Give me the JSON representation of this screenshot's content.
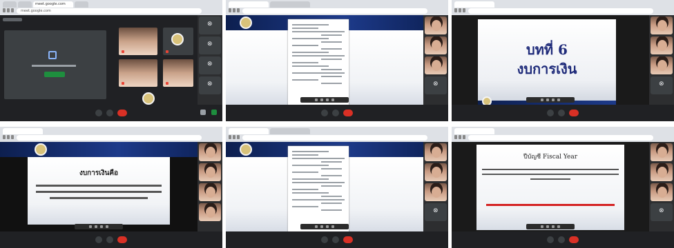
{
  "panels": [
    {
      "id": "meet-grid",
      "tab_label": "meet.google.com",
      "address": "meet.google.com",
      "tile_center_text": "",
      "bottom_text": "",
      "tiles": [
        {
          "label": ""
        },
        {
          "label": ""
        },
        {
          "label": ""
        },
        {
          "label": ""
        }
      ]
    },
    {
      "id": "doc-1",
      "tab_label": "",
      "address": ""
    },
    {
      "id": "chapter-title",
      "tab_label": "",
      "address": "",
      "title_line1": "บทที่ 6",
      "title_line2": "งบการเงิน"
    },
    {
      "id": "slide-text",
      "tab_label": "",
      "address": "",
      "heading": "งบการเงินคือ",
      "body": ""
    },
    {
      "id": "doc-2",
      "tab_label": "",
      "address": ""
    },
    {
      "id": "fiscal-year",
      "tab_label": "",
      "address": "",
      "heading": "ปีบัญชี Fiscal Year",
      "body": "",
      "red_note": ""
    }
  ],
  "colors": {
    "meet_bg": "#202124",
    "slide_header": "#1d3a8a",
    "title_color": "#1f2b7a",
    "red_note": "#d42020"
  },
  "icons": [
    "mic-icon",
    "camera-icon",
    "end-call-icon",
    "people-icon",
    "chat-icon"
  ]
}
